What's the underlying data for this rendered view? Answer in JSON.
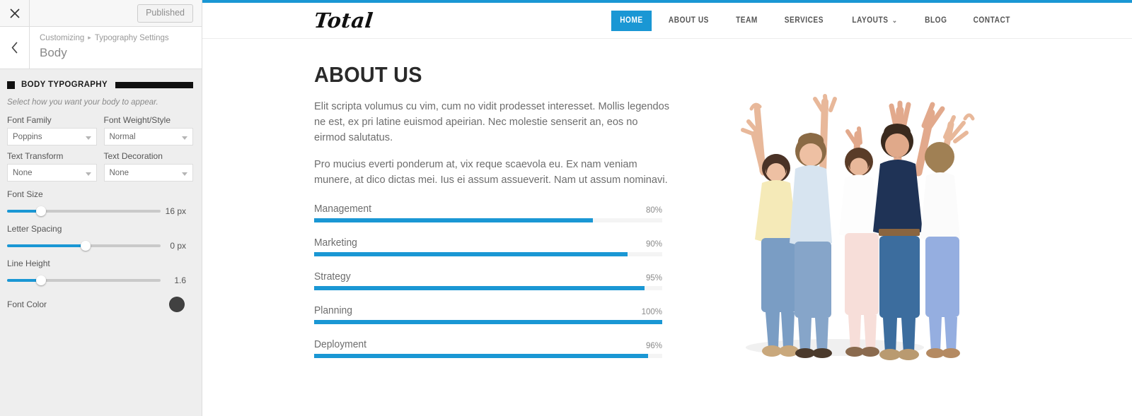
{
  "customizer": {
    "close_icon": "close-icon",
    "published_label": "Published",
    "back_icon": "chevron-left-icon",
    "breadcrumb": {
      "root": "Customizing",
      "separator": "▸",
      "parent": "Typography Settings"
    },
    "panel_title": "Body",
    "section": {
      "title": "BODY TYPOGRAPHY",
      "description": "Select how you want your body to appear."
    },
    "fields": [
      {
        "label": "Font Family",
        "value": "Poppins"
      },
      {
        "label": "Font Weight/Style",
        "value": "Normal"
      },
      {
        "label": "Text Transform",
        "value": "None"
      },
      {
        "label": "Text Decoration",
        "value": "None"
      }
    ],
    "sliders": [
      {
        "label": "Font Size",
        "value": "16 px",
        "percent": 22
      },
      {
        "label": "Letter Spacing",
        "value": "0 px",
        "percent": 51
      },
      {
        "label": "Line Height",
        "value": "1.6",
        "percent": 22
      }
    ],
    "color": {
      "label": "Font Color",
      "value": "#414141"
    }
  },
  "preview": {
    "accent_color": "#1a97d4",
    "logo": "Total",
    "nav": [
      {
        "label": "HOME",
        "active": true,
        "caret": ""
      },
      {
        "label": "ABOUT US",
        "active": false,
        "caret": ""
      },
      {
        "label": "TEAM",
        "active": false,
        "caret": ""
      },
      {
        "label": "SERVICES",
        "active": false,
        "caret": ""
      },
      {
        "label": "LAYOUTS",
        "active": false,
        "caret": "⌄"
      },
      {
        "label": "BLOG",
        "active": false,
        "caret": ""
      },
      {
        "label": "CONTACT",
        "active": false,
        "caret": ""
      }
    ],
    "about": {
      "title": "ABOUT US",
      "paragraph1": "Elit scripta volumus cu vim, cum no vidit prodesset interesset. Mollis legendos ne est, ex pri latine euismod apeirian. Nec molestie senserit an, eos no eirmod salutatus.",
      "paragraph2": "Pro mucius everti ponderum at, vix reque scaevola eu. Ex nam veniam munere, at dico dictas mei. Ius ei assum assueverit. Nam ut assum nominavi."
    },
    "image_alt": "group-of-people-cheering-photo"
  },
  "chart_data": {
    "type": "bar",
    "title": "",
    "orientation": "horizontal",
    "categories": [
      "Management",
      "Marketing",
      "Strategy",
      "Planning",
      "Deployment"
    ],
    "values": [
      80,
      90,
      95,
      100,
      96
    ],
    "value_labels": [
      "80%",
      "90%",
      "95%",
      "100%",
      "96%"
    ],
    "xlabel": "",
    "ylabel": "",
    "xlim": [
      0,
      100
    ],
    "grid": false,
    "legend": "none",
    "bar_color": "#1a97d4",
    "track_color": "#f4f4f4"
  }
}
